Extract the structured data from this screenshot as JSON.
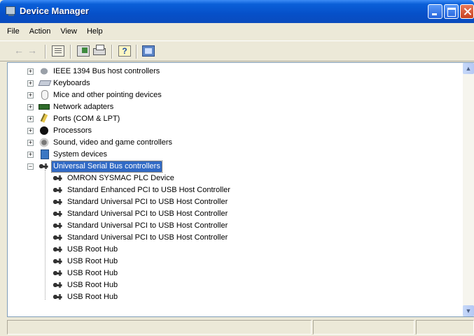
{
  "window": {
    "title": "Device Manager"
  },
  "menu": [
    "File",
    "Action",
    "View",
    "Help"
  ],
  "toolbar": {
    "icons": [
      "back-arrow-icon",
      "forward-arrow-icon",
      "properties-icon",
      "update-driver-icon",
      "print-icon",
      "help-icon",
      "scan-hardware-icon"
    ],
    "back_glyph": "←",
    "forward_glyph": "→",
    "help_glyph": "?"
  },
  "tree": {
    "categories": [
      {
        "label": "IEEE 1394 Bus host controllers",
        "expander": "+",
        "icon": "firewire-icon"
      },
      {
        "label": "Keyboards",
        "expander": "+",
        "icon": "keyboard-icon"
      },
      {
        "label": "Mice and other pointing devices",
        "expander": "+",
        "icon": "mouse-icon"
      },
      {
        "label": "Network adapters",
        "expander": "+",
        "icon": "network-adapter-icon"
      },
      {
        "label": "Ports (COM & LPT)",
        "expander": "+",
        "icon": "port-icon"
      },
      {
        "label": "Processors",
        "expander": "+",
        "icon": "processor-icon"
      },
      {
        "label": "Sound, video and game controllers",
        "expander": "+",
        "icon": "sound-icon"
      },
      {
        "label": "System devices",
        "expander": "+",
        "icon": "system-devices-icon"
      },
      {
        "label": "Universal Serial Bus controllers",
        "expander": "−",
        "icon": "usb-icon",
        "selected": true
      }
    ],
    "usb_children": [
      "OMRON SYSMAC PLC Device",
      "Standard Enhanced PCI to USB Host Controller",
      "Standard Universal PCI to USB Host Controller",
      "Standard Universal PCI to USB Host Controller",
      "Standard Universal PCI to USB Host Controller",
      "Standard Universal PCI to USB Host Controller",
      "USB Root Hub",
      "USB Root Hub",
      "USB Root Hub",
      "USB Root Hub",
      "USB Root Hub"
    ]
  },
  "scrollbar": {
    "up_glyph": "▲",
    "down_glyph": "▼"
  },
  "colors": {
    "titlebar": "#0650c9",
    "selection": "#316ac5",
    "chrome": "#ece9d8"
  }
}
